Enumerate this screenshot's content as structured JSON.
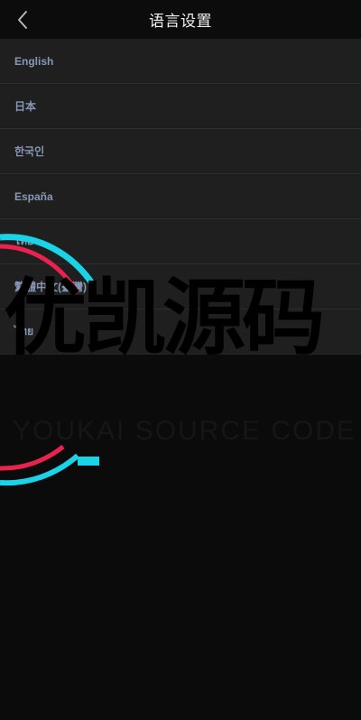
{
  "header": {
    "title": "语言设置",
    "back_icon": "chevron-left-icon"
  },
  "languages": [
    {
      "label": "English"
    },
    {
      "label": "日本"
    },
    {
      "label": "한국인"
    },
    {
      "label": "España"
    },
    {
      "label": "ไทย"
    },
    {
      "label": "繁體中文(臺灣)"
    },
    {
      "label": "ไทย"
    }
  ],
  "watermark": {
    "main_text": "优凯源码",
    "sub_text": "YOUKAI SOURCE CODE",
    "ring_colors": [
      "#1ad3e6",
      "#e8234f"
    ]
  },
  "colors": {
    "background": "#0b0b0b",
    "list_background": "#1f1f1f",
    "label": "#8798b6",
    "title": "#f2f2f2"
  }
}
